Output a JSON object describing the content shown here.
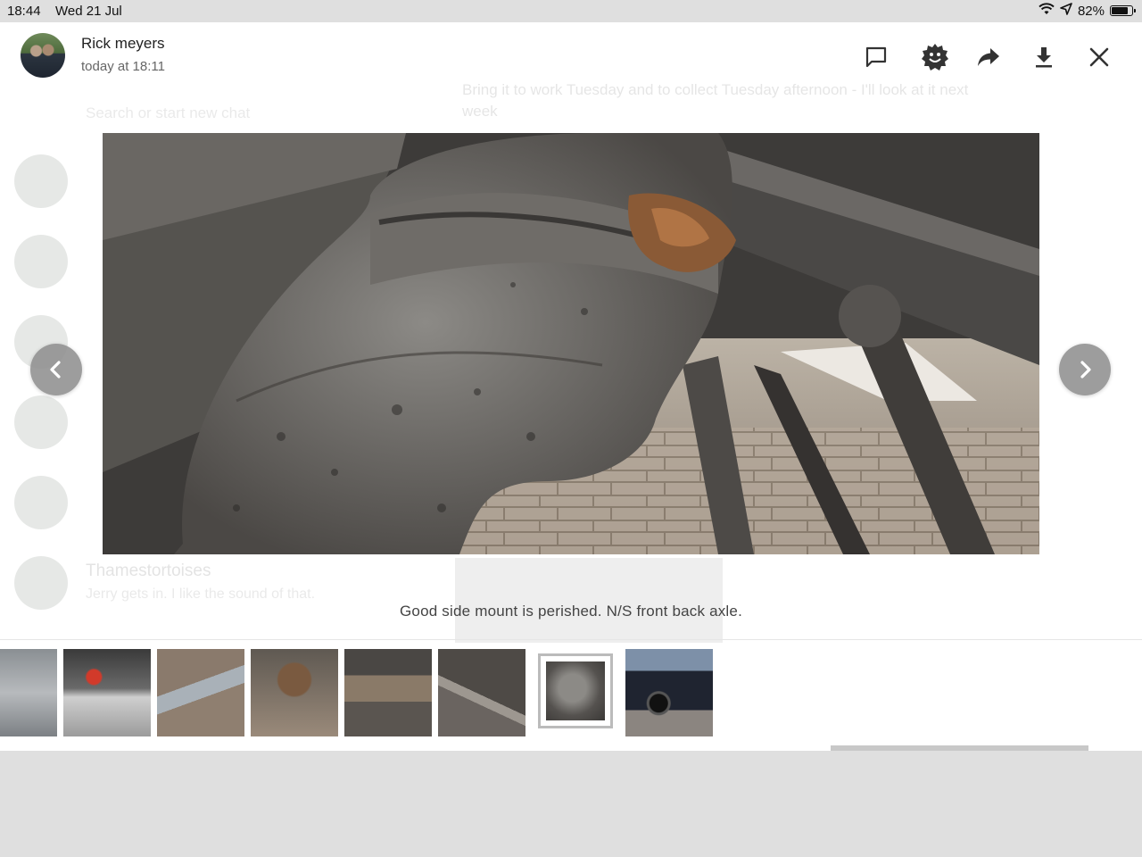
{
  "status_bar": {
    "time": "18:44",
    "date": "Wed 21 Jul",
    "battery": "82%",
    "battery_level": 0.82
  },
  "background": {
    "search_placeholder": "Search or start new chat",
    "message_preview": "Bring it to work Tuesday and to collect Tuesday afternoon - I'll look at it next week",
    "chat_last_name": "Thamestortoises",
    "chat_last_preview": "Jerry gets in. I like the sound of that."
  },
  "header": {
    "sender": "Rick meyers",
    "timestamp": "today at 18:11",
    "icons": [
      "reply-icon",
      "sticker-icon",
      "forward-icon",
      "download-icon",
      "close-icon"
    ]
  },
  "viewer": {
    "caption": "Good side mount is perished. N/S front back axle.",
    "prev_icon": "chevron-left-icon",
    "next_icon": "chevron-right-icon"
  },
  "thumbnails": {
    "count": 8,
    "selected_index": 6
  }
}
